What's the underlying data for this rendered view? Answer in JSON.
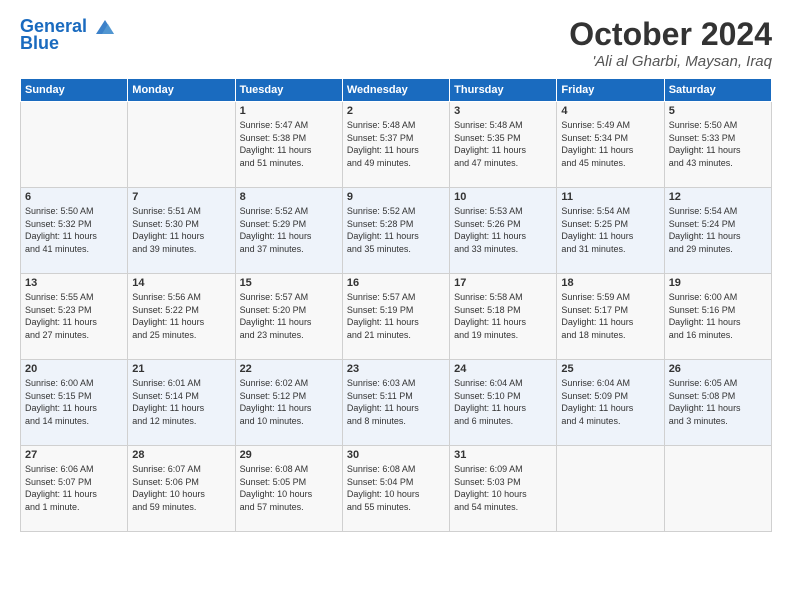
{
  "header": {
    "logo_line1": "General",
    "logo_line2": "Blue",
    "month": "October 2024",
    "location": "'Ali al Gharbi, Maysan, Iraq"
  },
  "days_of_week": [
    "Sunday",
    "Monday",
    "Tuesday",
    "Wednesday",
    "Thursday",
    "Friday",
    "Saturday"
  ],
  "weeks": [
    [
      {
        "day": "",
        "info": ""
      },
      {
        "day": "",
        "info": ""
      },
      {
        "day": "1",
        "info": "Sunrise: 5:47 AM\nSunset: 5:38 PM\nDaylight: 11 hours\nand 51 minutes."
      },
      {
        "day": "2",
        "info": "Sunrise: 5:48 AM\nSunset: 5:37 PM\nDaylight: 11 hours\nand 49 minutes."
      },
      {
        "day": "3",
        "info": "Sunrise: 5:48 AM\nSunset: 5:35 PM\nDaylight: 11 hours\nand 47 minutes."
      },
      {
        "day": "4",
        "info": "Sunrise: 5:49 AM\nSunset: 5:34 PM\nDaylight: 11 hours\nand 45 minutes."
      },
      {
        "day": "5",
        "info": "Sunrise: 5:50 AM\nSunset: 5:33 PM\nDaylight: 11 hours\nand 43 minutes."
      }
    ],
    [
      {
        "day": "6",
        "info": "Sunrise: 5:50 AM\nSunset: 5:32 PM\nDaylight: 11 hours\nand 41 minutes."
      },
      {
        "day": "7",
        "info": "Sunrise: 5:51 AM\nSunset: 5:30 PM\nDaylight: 11 hours\nand 39 minutes."
      },
      {
        "day": "8",
        "info": "Sunrise: 5:52 AM\nSunset: 5:29 PM\nDaylight: 11 hours\nand 37 minutes."
      },
      {
        "day": "9",
        "info": "Sunrise: 5:52 AM\nSunset: 5:28 PM\nDaylight: 11 hours\nand 35 minutes."
      },
      {
        "day": "10",
        "info": "Sunrise: 5:53 AM\nSunset: 5:26 PM\nDaylight: 11 hours\nand 33 minutes."
      },
      {
        "day": "11",
        "info": "Sunrise: 5:54 AM\nSunset: 5:25 PM\nDaylight: 11 hours\nand 31 minutes."
      },
      {
        "day": "12",
        "info": "Sunrise: 5:54 AM\nSunset: 5:24 PM\nDaylight: 11 hours\nand 29 minutes."
      }
    ],
    [
      {
        "day": "13",
        "info": "Sunrise: 5:55 AM\nSunset: 5:23 PM\nDaylight: 11 hours\nand 27 minutes."
      },
      {
        "day": "14",
        "info": "Sunrise: 5:56 AM\nSunset: 5:22 PM\nDaylight: 11 hours\nand 25 minutes."
      },
      {
        "day": "15",
        "info": "Sunrise: 5:57 AM\nSunset: 5:20 PM\nDaylight: 11 hours\nand 23 minutes."
      },
      {
        "day": "16",
        "info": "Sunrise: 5:57 AM\nSunset: 5:19 PM\nDaylight: 11 hours\nand 21 minutes."
      },
      {
        "day": "17",
        "info": "Sunrise: 5:58 AM\nSunset: 5:18 PM\nDaylight: 11 hours\nand 19 minutes."
      },
      {
        "day": "18",
        "info": "Sunrise: 5:59 AM\nSunset: 5:17 PM\nDaylight: 11 hours\nand 18 minutes."
      },
      {
        "day": "19",
        "info": "Sunrise: 6:00 AM\nSunset: 5:16 PM\nDaylight: 11 hours\nand 16 minutes."
      }
    ],
    [
      {
        "day": "20",
        "info": "Sunrise: 6:00 AM\nSunset: 5:15 PM\nDaylight: 11 hours\nand 14 minutes."
      },
      {
        "day": "21",
        "info": "Sunrise: 6:01 AM\nSunset: 5:14 PM\nDaylight: 11 hours\nand 12 minutes."
      },
      {
        "day": "22",
        "info": "Sunrise: 6:02 AM\nSunset: 5:12 PM\nDaylight: 11 hours\nand 10 minutes."
      },
      {
        "day": "23",
        "info": "Sunrise: 6:03 AM\nSunset: 5:11 PM\nDaylight: 11 hours\nand 8 minutes."
      },
      {
        "day": "24",
        "info": "Sunrise: 6:04 AM\nSunset: 5:10 PM\nDaylight: 11 hours\nand 6 minutes."
      },
      {
        "day": "25",
        "info": "Sunrise: 6:04 AM\nSunset: 5:09 PM\nDaylight: 11 hours\nand 4 minutes."
      },
      {
        "day": "26",
        "info": "Sunrise: 6:05 AM\nSunset: 5:08 PM\nDaylight: 11 hours\nand 3 minutes."
      }
    ],
    [
      {
        "day": "27",
        "info": "Sunrise: 6:06 AM\nSunset: 5:07 PM\nDaylight: 11 hours\nand 1 minute."
      },
      {
        "day": "28",
        "info": "Sunrise: 6:07 AM\nSunset: 5:06 PM\nDaylight: 10 hours\nand 59 minutes."
      },
      {
        "day": "29",
        "info": "Sunrise: 6:08 AM\nSunset: 5:05 PM\nDaylight: 10 hours\nand 57 minutes."
      },
      {
        "day": "30",
        "info": "Sunrise: 6:08 AM\nSunset: 5:04 PM\nDaylight: 10 hours\nand 55 minutes."
      },
      {
        "day": "31",
        "info": "Sunrise: 6:09 AM\nSunset: 5:03 PM\nDaylight: 10 hours\nand 54 minutes."
      },
      {
        "day": "",
        "info": ""
      },
      {
        "day": "",
        "info": ""
      }
    ]
  ]
}
